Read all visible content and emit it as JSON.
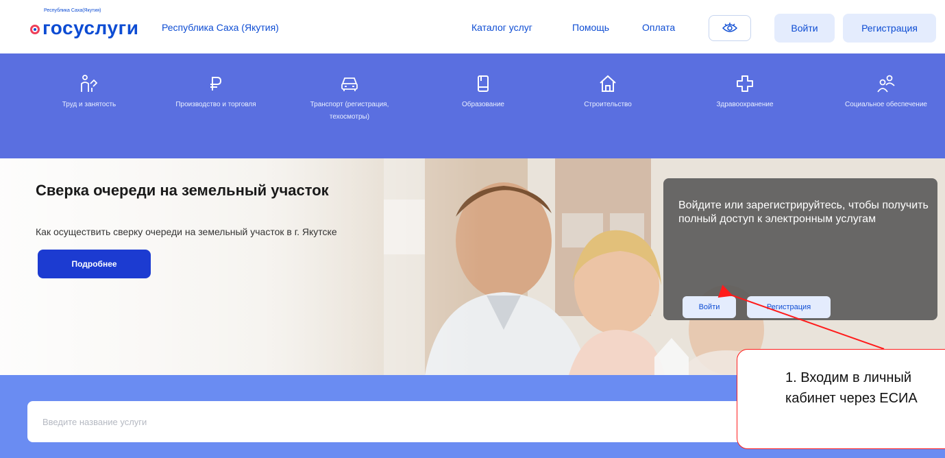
{
  "header": {
    "logo_top": "Республика Саха(Якутия)",
    "logo_word_1": "гос",
    "logo_word_2": "услуги",
    "region": "Республика Саха (Якутия)",
    "nav": [
      "Каталог услуг",
      "Помощь",
      "Оплата"
    ],
    "accessibility_icon": "eye-icon",
    "login_label": "Войти",
    "register_label": "Регистрация"
  },
  "categories": [
    {
      "label": "Труд и занятость",
      "icon": "people-work-icon"
    },
    {
      "label": "Производство и торговля",
      "icon": "ruble-icon"
    },
    {
      "label": "Транспорт (регистрация, техосмотры)",
      "icon": "car-icon"
    },
    {
      "label": "Образование",
      "icon": "book-icon"
    },
    {
      "label": "Строительство",
      "icon": "house-icon"
    },
    {
      "label": "Здравоохранение",
      "icon": "medical-cross-icon"
    },
    {
      "label": "Социальное обеспечение",
      "icon": "people-icon"
    }
  ],
  "hero": {
    "title": "Сверка очереди на земельный участок",
    "subtitle": "Как осуществить сверку очереди на земельный участок в г. Якутске",
    "button": "Подробнее"
  },
  "login_card": {
    "text": "Войдите или зарегистрируйтесь, чтобы получить полный доступ к электронным услугам",
    "login": "Войти",
    "register": "Регистрация"
  },
  "search": {
    "placeholder": "Введите название услуги"
  },
  "annotation": {
    "line1": "1. Входим в личный",
    "line2": "кабинет через ЕСИА"
  },
  "colors": {
    "brand_blue": "#0d4cd3",
    "brand_red": "#ee3f58",
    "category_bar": "#5a6fe0",
    "search_band": "#6a8cf2",
    "annotation_red": "#ff1b1b"
  }
}
